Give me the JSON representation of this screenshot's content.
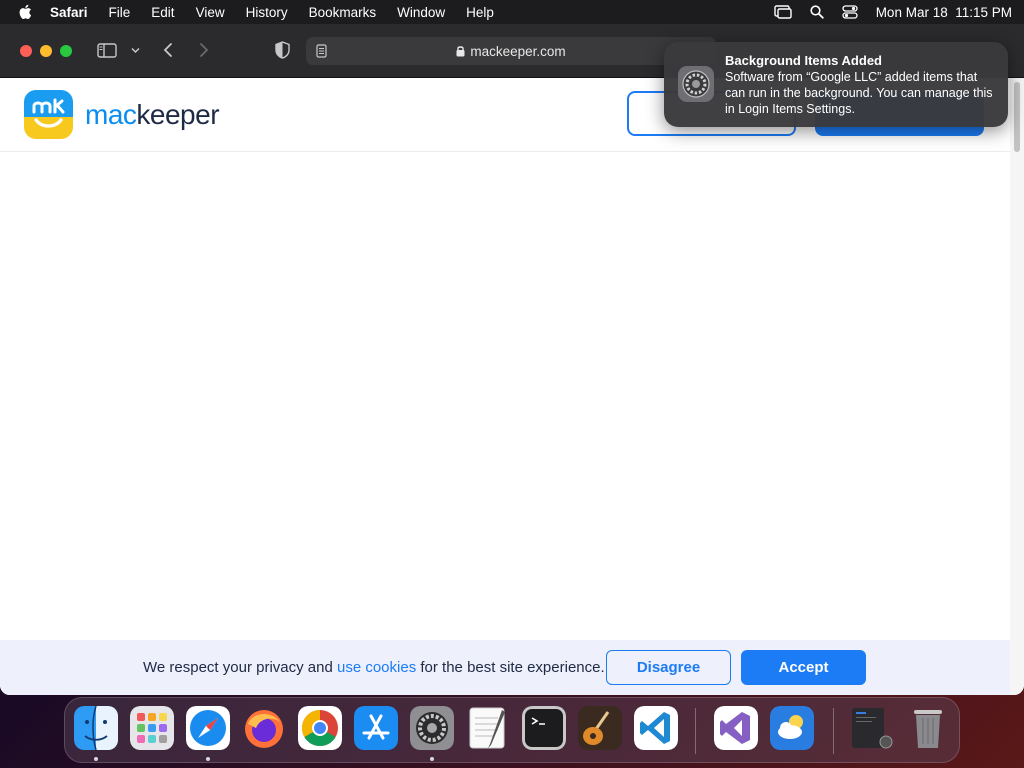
{
  "menubar": {
    "app_name": "Safari",
    "items": [
      "File",
      "Edit",
      "View",
      "History",
      "Bookmarks",
      "Window",
      "Help"
    ],
    "clock": "Mon Mar 18  11:15 PM"
  },
  "browser": {
    "url": "mackeeper.com"
  },
  "site": {
    "logo_prefix": "mac",
    "logo_suffix": "keeper"
  },
  "cookie": {
    "text_before": "We respect your privacy and ",
    "link_text": "use cookies",
    "text_after": " for the best site experience.",
    "disagree_label": "Disagree",
    "accept_label": "Accept"
  },
  "notification": {
    "title": "Background Items Added",
    "body": "Software from “Google LLC” added items that can run in the background. You can manage this in Login Items Settings."
  },
  "colors": {
    "accent": "#1c7cf5",
    "menubar": "#1c1c1e",
    "toolbar": "#2b2b2d"
  },
  "dock": {
    "apps": [
      "Finder",
      "Launchpad",
      "Safari",
      "Firefox",
      "Chrome",
      "App Store",
      "System Settings",
      "TextEdit",
      "Terminal",
      "GarageBand",
      "Visual Studio Code",
      "Visual Studio",
      "Weather",
      "Downloads",
      "Trash"
    ]
  }
}
